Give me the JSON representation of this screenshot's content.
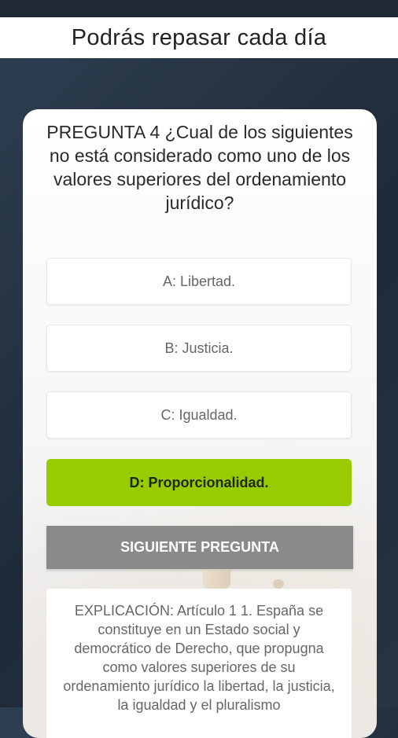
{
  "header": {
    "title": "Podrás repasar cada día"
  },
  "question": {
    "text": "PREGUNTA 4 ¿Cual de los siguientes no está considerado como uno de los valores superiores del ordenamiento jurídico?"
  },
  "options": [
    {
      "label": "A: Libertad.",
      "state": "normal"
    },
    {
      "label": "B: Justicia.",
      "state": "normal"
    },
    {
      "label": "C: Igualdad.",
      "state": "normal"
    },
    {
      "label": "D: Proporcionalidad.",
      "state": "correct"
    }
  ],
  "next_button": {
    "label": "SIGUIENTE PREGUNTA"
  },
  "explanation": {
    "text": "EXPLICACIÓN: Artículo 1 1. España se constituye en un Estado social y democrático de Derecho, que propugna como valores superiores de su ordenamiento jurídico la libertad, la justicia, la igualdad y el pluralismo"
  },
  "colors": {
    "correct": "#99cc00",
    "next_button": "#8a8a8a"
  }
}
